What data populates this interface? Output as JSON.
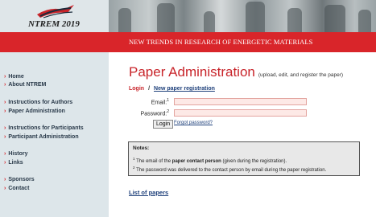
{
  "header": {
    "logo_text": "NTREM 2019",
    "banner_title": "NEW TRENDS IN RESEARCH OF ENERGETIC MATERIALS"
  },
  "sidebar": {
    "items": [
      {
        "label": "Home"
      },
      {
        "label": "About NTREM"
      },
      {
        "label": "Instructions for Authors"
      },
      {
        "label": "Paper Administration"
      },
      {
        "label": "Instructions for Participants"
      },
      {
        "label": "Participant Administration"
      },
      {
        "label": "History"
      },
      {
        "label": "Links"
      },
      {
        "label": "Sponsors"
      },
      {
        "label": "Contact"
      }
    ],
    "arrow": "›"
  },
  "main": {
    "title": "Paper Administration",
    "subtitle": "(upload, edit, and register the paper)",
    "login_label": "Login",
    "separator": "/",
    "new_registration": "New paper registration",
    "email_label": "Email:",
    "email_note": "1",
    "password_label": "Password:",
    "password_note": "2",
    "email_value": "",
    "password_value": "",
    "login_button": "Login",
    "forgot_password": "Forgot password?",
    "notes": {
      "title": "Notes:",
      "note1_num": "1",
      "note1_pre": "The email of the ",
      "note1_bold": "paper contact person",
      "note1_post": " (given during the registration).",
      "note2_num": "2",
      "note2_text": "The password was delivered to the contact person by email during the paper registration."
    },
    "list_of_papers": "List of papers"
  },
  "colors": {
    "accent_red": "#d9252a",
    "link_blue": "#1d3f7a",
    "sidebar_bg": "#dde6ea",
    "input_bg": "#fde9e6"
  }
}
